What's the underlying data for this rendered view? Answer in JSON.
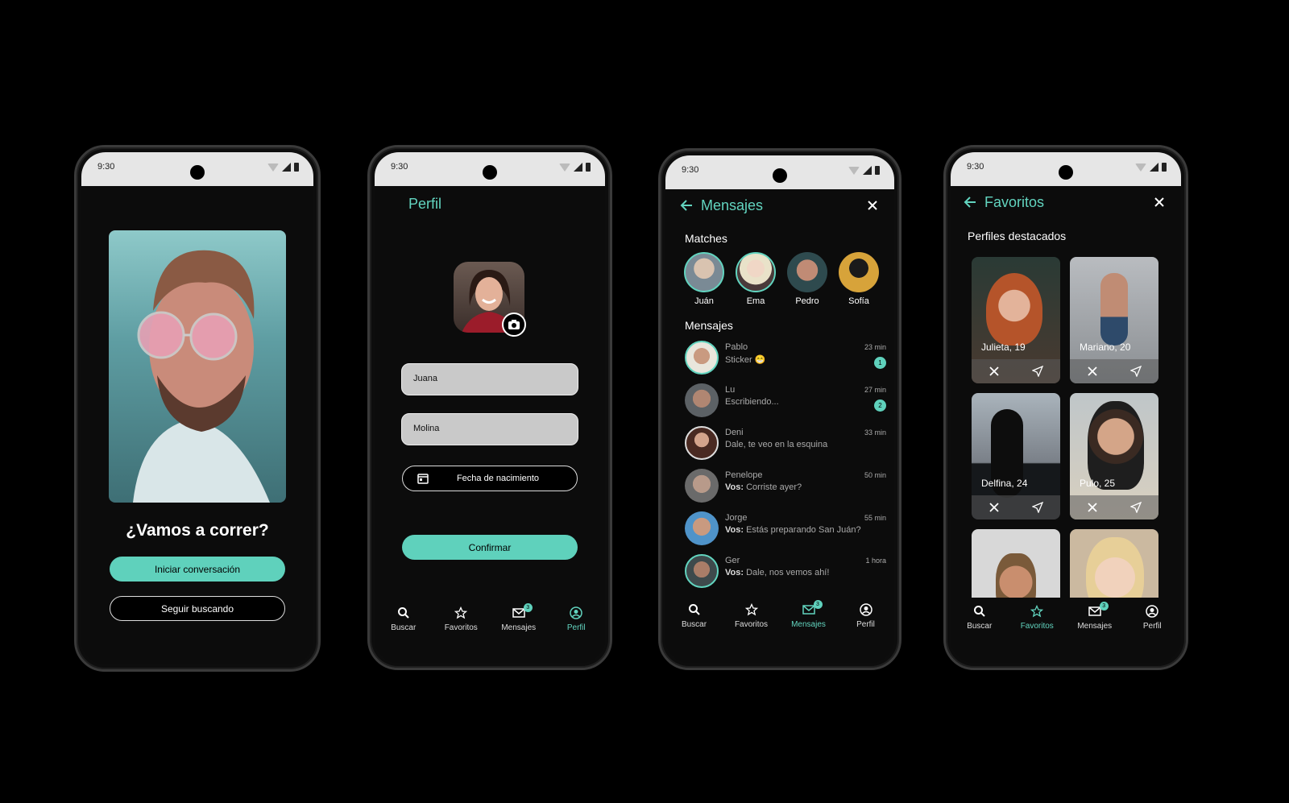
{
  "status_time": "9:30",
  "colors": {
    "accent": "#5fd1bc",
    "background": "#0c0c0c",
    "statusbar": "#e6e6e6",
    "field": "#c9c9c9"
  },
  "nav": [
    {
      "label": "Buscar",
      "icon": "search-icon"
    },
    {
      "label": "Favoritos",
      "icon": "star-icon"
    },
    {
      "label": "Mensajes",
      "icon": "mail-icon",
      "badge": "3"
    },
    {
      "label": "Perfil",
      "icon": "profile-icon"
    }
  ],
  "screen1": {
    "heading": "¿Vamos a correr?",
    "primary_button": "Iniciar conversación",
    "secondary_button": "Seguir buscando"
  },
  "screen2": {
    "title": "Perfil",
    "first_name": "Juana",
    "last_name": "Molina",
    "birthdate_button": "Fecha de nacimiento",
    "confirm_button": "Confirmar"
  },
  "screen3": {
    "title": "Mensajes",
    "matches_label": "Matches",
    "matches": [
      "Juán",
      "Ema",
      "Pedro",
      "Sofía"
    ],
    "messages_label": "Mensajes",
    "messages": [
      {
        "name": "Pablo",
        "prefix": "",
        "text": "Sticker 😁",
        "time": "23 min",
        "badge": "1"
      },
      {
        "name": "Lu",
        "prefix": "",
        "text": "Escribiendo...",
        "time": "27 min",
        "badge": "2"
      },
      {
        "name": "Deni",
        "prefix": "",
        "text": "Dale, te veo en la esquina",
        "time": "33 min",
        "badge": ""
      },
      {
        "name": "Penelope",
        "prefix": "Vos:",
        "text": "Corriste ayer?",
        "time": "50 min",
        "badge": ""
      },
      {
        "name": "Jorge",
        "prefix": "Vos:",
        "text": "Estás preparando San Juán?",
        "time": "55 min",
        "badge": ""
      },
      {
        "name": "Ger",
        "prefix": "Vos:",
        "text": "Dale, nos vemos ahí!",
        "time": "1 hora",
        "badge": ""
      }
    ]
  },
  "screen4": {
    "title": "Favoritos",
    "section_label": "Perfiles destacados",
    "cards": [
      {
        "caption": "Julieta, 19"
      },
      {
        "caption": "Mariano, 20"
      },
      {
        "caption": "Delfina, 24"
      },
      {
        "caption": "Pulo, 25"
      },
      {
        "caption": ""
      },
      {
        "caption": ""
      }
    ]
  }
}
